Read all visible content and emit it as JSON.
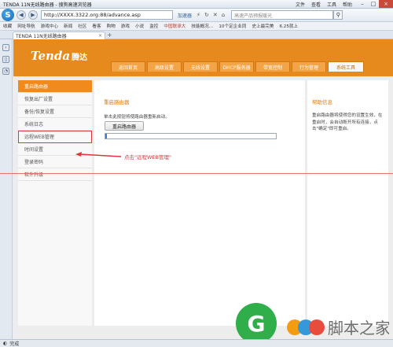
{
  "window": {
    "title": "TENDA 11N无线路由器 - 搜狗高速浏览器",
    "menu": [
      "文件",
      "查看",
      "工具",
      "帮助"
    ]
  },
  "address": {
    "url": "http://XXXX.3322.org:88/advance.asp",
    "accelerator": "加速器",
    "search_placeholder": "高速产品预报暖光"
  },
  "favorites": [
    "收藏",
    "网址导航",
    "游戏中心",
    "新闻",
    "社区",
    "看客",
    "购物",
    "游戏",
    "小说",
    "监控",
    "中国联承大",
    "技能概况…",
    "10个定企业同",
    "史上最完美",
    "6.25就上"
  ],
  "tab": {
    "label": "TENDA 11N无线路由器"
  },
  "header": {
    "brand_en": "Tenda",
    "brand_cn": "腾达",
    "nav": [
      "返回首页",
      "高级设置",
      "无线设置",
      "DHCP服务器",
      "带宽控制",
      "行为管理",
      "系统工具"
    ],
    "active_nav": 6
  },
  "sidebar": {
    "items": [
      "重启路由器",
      "恢复出厂设置",
      "备份/恢复设置",
      "系统日志",
      "远程WEB管理",
      "时间设置",
      "登录密码",
      "软件升级"
    ]
  },
  "main": {
    "title": "重启路由器",
    "description": "单击此按钮将使路由器重新启动。",
    "button": "重启路由器",
    "progress": 0.01
  },
  "help": {
    "title": "帮助信息",
    "text": "重启路由器将使得您的设置生效，在重启时，会自动断开所有连接，点击\"确定\"即可重启。"
  },
  "annotation": "点击\"远程WEB管理\"",
  "watermark": "脚本之家",
  "status": "完成",
  "colors": {
    "accent": "#e68a1d",
    "annotation": "#d93a3a"
  }
}
